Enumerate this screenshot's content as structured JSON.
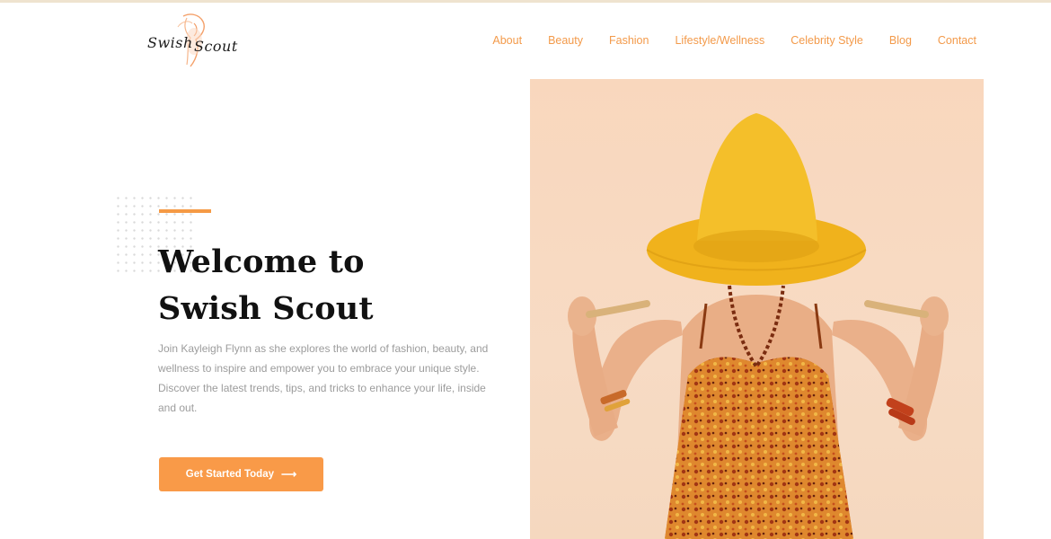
{
  "brand": {
    "logo_word1": "Swish",
    "logo_word2": "Scout",
    "logo_art": "peach-sketch-woman-illustration"
  },
  "nav": {
    "items": [
      "About",
      "Beauty",
      "Fashion",
      "Lifestyle/Wellness",
      "Celebrity Style",
      "Blog",
      "Contact"
    ]
  },
  "hero": {
    "headline_line1": "Welcome to",
    "headline_line2": "Swish Scout",
    "intro": "Join Kayleigh Flynn as she explores the world of fashion, beauty, and wellness to inspire and empower you to embrace your unique style. Discover the latest trends, tips, and tricks to enhance your life, inside and out.",
    "cta_label": "Get Started Today",
    "cta_icon": "arrow-right-icon",
    "image": "woman-in-yellow-straw-hat-and-floral-dress"
  },
  "colors": {
    "accent": "#f99a48",
    "nav_text": "#f39a4a",
    "body_text": "#9c9c9c",
    "heading": "#111111",
    "hero_background": "#f8d8c0"
  }
}
